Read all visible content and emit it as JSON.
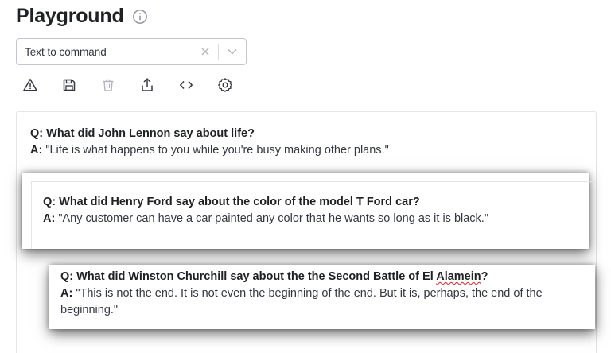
{
  "header": {
    "title": "Playground"
  },
  "preset": {
    "value": "Text to command"
  },
  "toolbar": {
    "buttons": [
      "warning-icon",
      "save-icon",
      "delete-icon",
      "share-icon",
      "code-icon",
      "settings-icon"
    ]
  },
  "conversation": [
    {
      "q_label": "Q:",
      "question": "What did John Lennon say about life?",
      "a_label": "A:",
      "answer": "\"Life is what happens to you while you're busy making other plans.\""
    },
    {
      "q_label": "Q:",
      "question": "What did Henry Ford say about the color of the model T Ford car?",
      "a_label": "A:",
      "answer": "\"Any customer can have a car painted any color that he wants so long as it is black.\""
    },
    {
      "q_label": "Q:",
      "question_pre": "What did Winston Churchill say about the the Second Battle of El ",
      "question_flagged": "Alamein",
      "question_post": "?",
      "a_label": "A:",
      "answer": "\"This is not the end. It is not even the beginning of the end. But it is, perhaps, the end of the beginning.\""
    }
  ]
}
